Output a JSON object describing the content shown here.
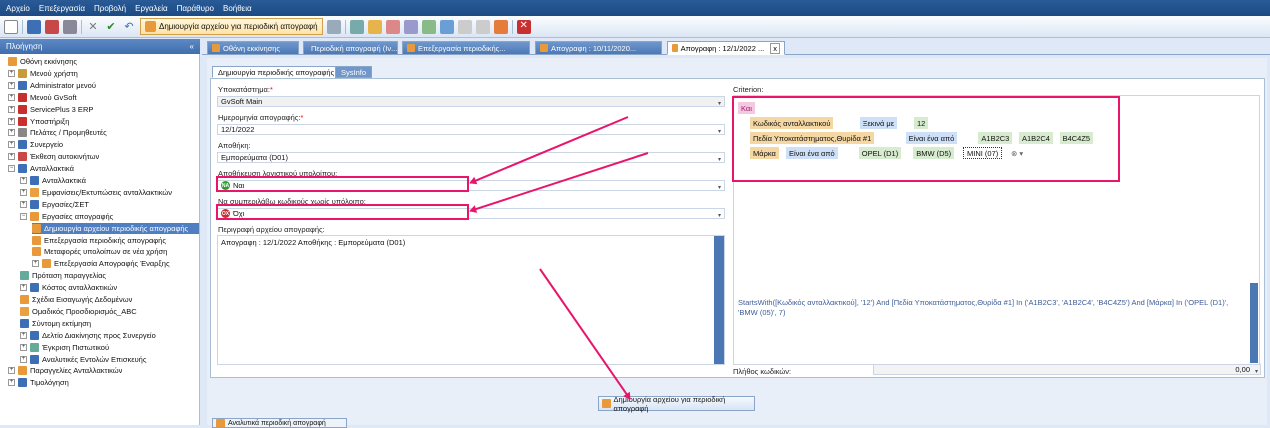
{
  "menu": [
    "Αρχείο",
    "Επεξεργασία",
    "Προβολή",
    "Εργαλεία",
    "Παράθυρο",
    "Βοήθεια"
  ],
  "toolbar": {
    "main_button": "Δημιουργία αρχείου για περιοδική απογραφή"
  },
  "nav": {
    "title": "Πλοήγηση",
    "collapse": "«",
    "items": [
      "Οθόνη εκκίνησης",
      "Μενού χρήστη",
      "Administrator μενού",
      "Μενού GvSoft",
      "ServicePlus 3 ERP",
      "Υποστήριξη",
      "Πελάτες / Προμηθευτές",
      "Συνεργείο",
      "Έκθεση αυτοκινήτων",
      "Ανταλλακτικά",
      "Ανταλλακτικά",
      "Εμφανίσεις/Εκτυπώσεις ανταλλακτικών",
      "Εργασίες/ΣΕΤ",
      "Εργασίες απογραφής",
      "Δημιουργία αρχείου περιοδικής απογραφής",
      "Επεξεργασία περιοδικής απογραφής",
      "Μεταφορές υπολοίπων σε νέα χρήση",
      "Επεξεργασία Απογραφής Έναρξης",
      "Πρόταση παραγγελίας",
      "Κόστος ανταλλακτικών",
      "Σχέδια Εισαγωγής Δεδομένων",
      "Ομαδικός Προσδιορισμός_ABC",
      "Σύντομη εκτίμηση",
      "Δελτίο Διακίνησης προς Συνεργείο",
      "Έγκριση Πιστωτικού",
      "Αναλυτικές Εντολών Επισκευής",
      "Παραγγελίες Ανταλλακτικών",
      "Τιμολόγηση"
    ]
  },
  "tabs": [
    "Οθόνη εκκίνησης",
    "Περιοδική απογραφή (Ιν...",
    "Επεξεργασία περιοδικής...",
    "Απογραφη : 10/11/2020...",
    "Απογραφη : 12/1/2022 ..."
  ],
  "tab_close": "x",
  "subtabs": [
    "Δημιουργία περιοδικής απογραφής",
    "SysInfo"
  ],
  "form": {
    "subsystem_label": "Υποκατάστημα:",
    "subsystem_value": "GvSoft Main",
    "date_label": "Ημερομηνία απογραφής:",
    "date_value": "12/1/2022",
    "warehouse_label": "Αποθήκη:",
    "warehouse_value": "Εμπορεύματα (D01)",
    "autocalc_label": "Αποθήκευση λογιστικού υπολοίπου:",
    "autocalc_badge": "ΝΑ",
    "autocalc_value": "Ναι",
    "zero_label": "Να συμπεριλάβω κωδικούς χωρίς υπόλοιπο:",
    "zero_badge": "ΟΧ",
    "zero_value": "Όχι",
    "desc_label": "Περιγραφή αρχείου απογραφής:",
    "desc_value": "Απογραφη : 12/1/2022   Αποθήκης : Εμπορεύματα (D01)",
    "required": "*"
  },
  "criterion": {
    "label": "Criterion:",
    "root": "Και",
    "row1": [
      "Κωδικός ανταλλακτικού",
      "Ξεκινά με",
      "12"
    ],
    "row2": [
      "Πεδία Υποκατάστηματος,Θυρίδα #1",
      "Είναι ένα από",
      "A1B2C3",
      "A1B2C4",
      "B4C4Z5"
    ],
    "row3": [
      "Μάρκα",
      "Είναι ένα από",
      "OPEL (D1)",
      "BMW (D5)",
      "MINI (07)"
    ],
    "expression": "StartsWith([Κωδικός ανταλλακτικού], '12') And [Πεδία Υποκατάστηματος,Θυρίδα #1] In ('A1B2C3', 'A1B2C4', 'B4C4Z5') And [Μάρκα] In ('OPEL (D1)', 'BMW (05)', 7)"
  },
  "count": {
    "label": "Πλήθος κωδικών:",
    "value": "0,00"
  },
  "action_button": "Δημιουργία αρχείου για περιοδική απογραφή",
  "bottom_partial": "Αναλυτικά περιοδική απογραφή"
}
